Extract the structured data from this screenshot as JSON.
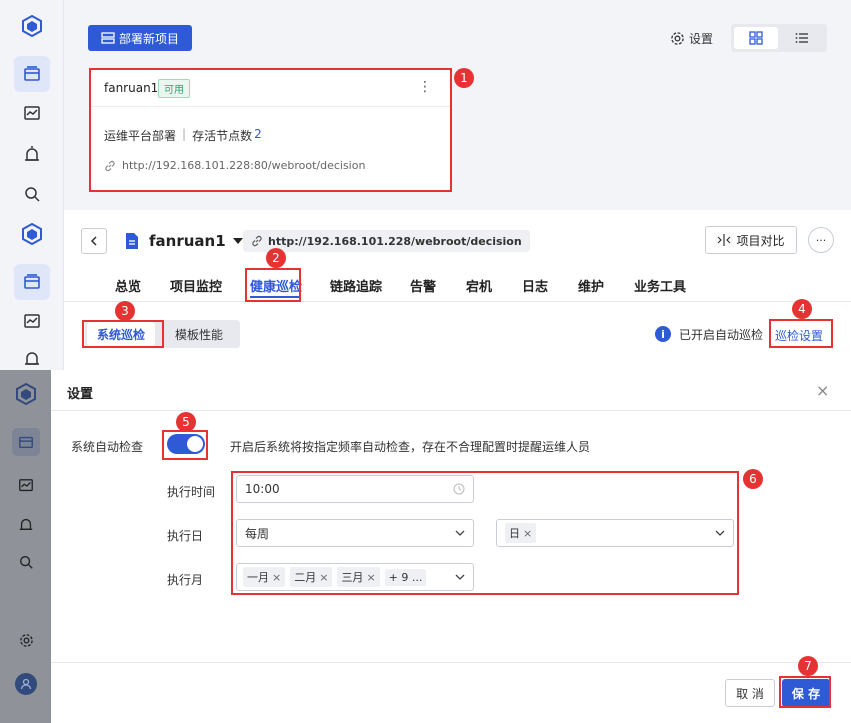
{
  "deploy_btn": "部署新项目",
  "settings_link": "设置",
  "card": {
    "name": "fanruan1",
    "status": "可用",
    "platform": "运维平台部署",
    "sep": "|",
    "nodes_label": "存活节点数",
    "nodes_value": "2",
    "url": "http://192.168.101.228:80/webroot/decision"
  },
  "project": {
    "name": "fanruan1",
    "url": "http://192.168.101.228/webroot/decision",
    "compare_btn": "项目对比"
  },
  "tabs": [
    "总览",
    "项目监控",
    "健康巡检",
    "链路追踪",
    "告警",
    "宕机",
    "日志",
    "维护",
    "业务工具"
  ],
  "subtabs": [
    "系统巡检",
    "模板性能"
  ],
  "auto_status": "已开启自动巡检",
  "inspect_settings": "巡检设置",
  "dialog": {
    "title": "设置",
    "auto_label": "系统自动检查",
    "auto_desc": "开启后系统将按指定频率自动检查，存在不合理配置时提醒运维人员",
    "time_label": "执行时间",
    "time_value": "10:00",
    "day_label": "执行日",
    "day_value": "每周",
    "day_tags": [
      "日"
    ],
    "month_label": "执行月",
    "month_tags": [
      "一月",
      "二月",
      "三月",
      "+ 9 ..."
    ],
    "cancel": "取 消",
    "save": "保 存"
  },
  "badges": [
    "1",
    "2",
    "3",
    "4",
    "5",
    "6",
    "7"
  ],
  "colors": {
    "primary": "#2e5ad6",
    "annotation": "#e53333",
    "status_green": "#2ba471"
  }
}
